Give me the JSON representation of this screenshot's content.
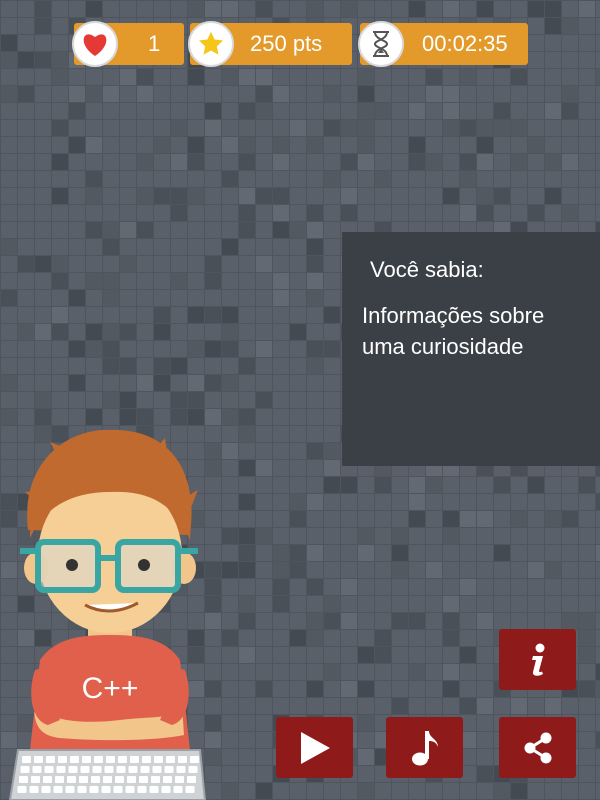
{
  "hud": {
    "lives": {
      "icon": "heart-icon",
      "value": "1"
    },
    "score": {
      "icon": "star-icon",
      "value": "250 pts"
    },
    "timer": {
      "icon": "hourglass-icon",
      "value": "00:02:35"
    }
  },
  "info_panel": {
    "title": "Você sabia:",
    "body": "Informações sobre uma curiosidade"
  },
  "character": {
    "shirt_text": "C++"
  },
  "buttons": [
    {
      "name": "info-button",
      "icon": "info-icon"
    },
    {
      "name": "play-button",
      "icon": "play-icon"
    },
    {
      "name": "music-button",
      "icon": "music-note-icon"
    },
    {
      "name": "share-button",
      "icon": "share-icon"
    }
  ],
  "colors": {
    "hud_pill": "#e39a2b",
    "button": "#8e1a1a",
    "panel": "#3b3f46",
    "heart": "#e53935",
    "star": "#f5c518"
  }
}
